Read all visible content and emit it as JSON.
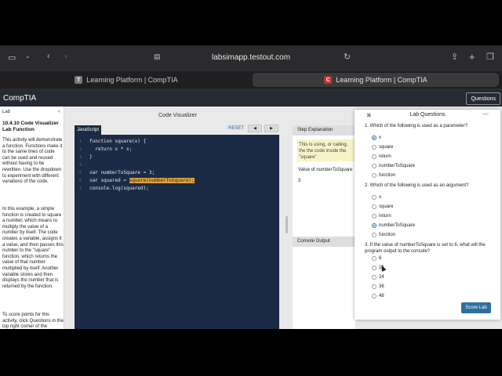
{
  "browser": {
    "url": "labsimapp.testout.com",
    "tabs": [
      {
        "label": "Learning Platform | CompTIA",
        "favicon": "T"
      },
      {
        "label": "Learning Platform | CompTIA",
        "favicon": "C"
      }
    ]
  },
  "app": {
    "brand": "CompTIA",
    "questions_button": "Questions"
  },
  "sidebar": {
    "lab_label": "Lab",
    "title": "10.4.10 Code Visualizer Lab Function",
    "para1": "This activity will demonstrate a function. Functions make it to the same lines of code can be used and reused without having to be rewritten. Use the dropdown to experiment with different variations of the code.",
    "para2": "In this example, a simple function is created to square a number, which means to multiply the value of a number by itself. The code creates a variable, assigns it a value, and then passes this number to the \"square\" function, which returns the value of that number multiplied by itself. Another variable stores and then displays the number that is returned by the function.",
    "para3": "To score points for this activity, click Questions in the top right corner of the"
  },
  "visualizer": {
    "title": "Code Visualizer",
    "reset": "RESET",
    "prev": "◀",
    "next": "▶",
    "language_tab": "JavaScript",
    "lines": [
      {
        "n": "1",
        "code": "function square(x) {"
      },
      {
        "n": "2",
        "code": "  return x * x;"
      },
      {
        "n": "3",
        "code": "}"
      },
      {
        "n": "4",
        "code": ""
      },
      {
        "n": "5",
        "code": "var numberToSquare = 3;"
      },
      {
        "n": "6",
        "pre": "var squared = ",
        "hl": "square(numberToSquare);"
      },
      {
        "n": "7",
        "code": "console.log(squared);"
      }
    ]
  },
  "step": {
    "header": "Step Explanation",
    "text": "This is using, or calling, the the code inside the \"square\" \"numberToSquare\" which",
    "value_of": "Value of",
    "value_var": "numberToSquare",
    "value": "3",
    "console_header": "Console Output"
  },
  "dialog": {
    "title": "Lab Questions",
    "close": "✖",
    "minimize": "—",
    "questions": [
      {
        "text": "1. Which of the following is used as a parameter?",
        "options": [
          "x",
          "square",
          "return",
          "numberToSquare",
          "function"
        ],
        "selected": 0
      },
      {
        "text": "2. Which of the following is used as an argument?",
        "options": [
          "x",
          "square",
          "return",
          "numberToSquare",
          "function"
        ],
        "selected": 3
      },
      {
        "text": "3. If the value of numberToSquare is set to 6, what will the program output to the console?",
        "options": [
          "6",
          "12",
          "24",
          "36",
          "48"
        ],
        "selected": -1
      }
    ],
    "score_button": "Score Lab"
  },
  "colors": {
    "editor_bg": "#1c2b45",
    "highlight": "#e0a23a",
    "accent": "#2f6f9e"
  }
}
